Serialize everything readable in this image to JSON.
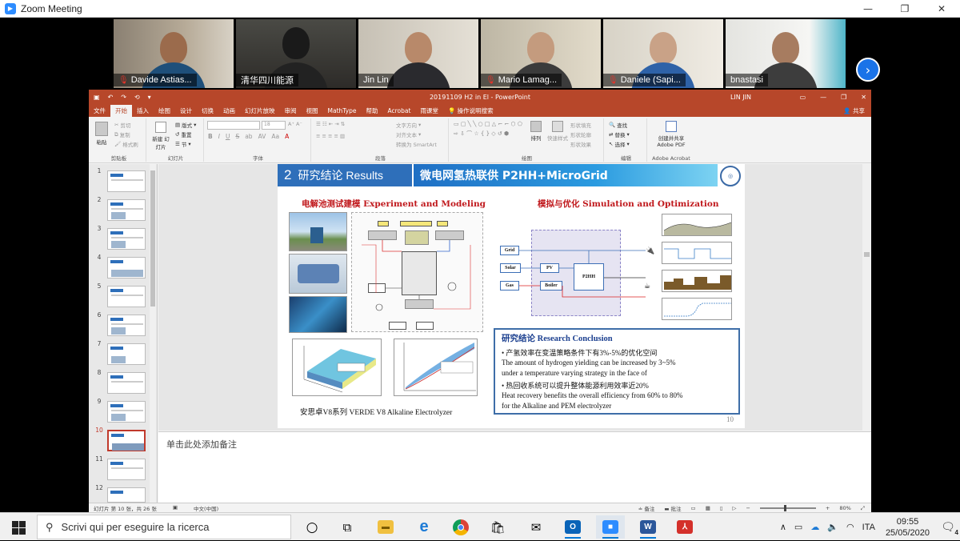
{
  "zoom": {
    "title": "Zoom Meeting",
    "window_controls": [
      "—",
      "❐",
      "✕"
    ],
    "participants": [
      {
        "name": "Davide Astias..."
      },
      {
        "name": "清华四川能源"
      },
      {
        "name": "Jin Lin"
      },
      {
        "name": "Mario Lamag..."
      },
      {
        "name": "Daniele (Sapi..."
      },
      {
        "name": "bnastasi"
      }
    ],
    "next_page_icon": "chevron-right-icon"
  },
  "ppt": {
    "doc_title": "20191109 H2 in El - PowerPoint",
    "user": "LIN JIN",
    "quick_access": [
      "▣",
      "↶",
      "↷",
      "⟲",
      "▾"
    ],
    "win_controls": [
      "▭",
      "—",
      "❐",
      "✕"
    ],
    "tabs": [
      "文件",
      "开始",
      "插入",
      "绘图",
      "设计",
      "切换",
      "动画",
      "幻灯片放映",
      "审阅",
      "视图",
      "MathType",
      "帮助",
      "Acrobat",
      "雨课堂",
      "操作说明搜索"
    ],
    "selected_tab": "开始",
    "share": "共享",
    "ribbon": {
      "clipboard": {
        "paste": "粘贴",
        "cut": "剪切",
        "copy": "复制",
        "format": "格式刷",
        "label": "剪贴板"
      },
      "slides": {
        "new": "新建 幻灯片",
        "layout": "版式",
        "reset": "重置",
        "section": "节",
        "label": "幻灯片"
      },
      "font": {
        "size": "18",
        "bold": "B",
        "italic": "I",
        "underline": "U",
        "strike": "S",
        "shadow": "ab",
        "label": "字体"
      },
      "paragraph": {
        "dir": "文字方向",
        "align": "对齐文本",
        "smartart": "转换为 SmartArt",
        "label": "段落"
      },
      "drawing": {
        "arrange": "排列",
        "quick": "快速样式",
        "fill": "形状填充",
        "outline": "形状轮廓",
        "effect": "形状效果",
        "label": "绘图"
      },
      "editing": {
        "find": "查找",
        "replace": "替换",
        "select": "选择",
        "label": "编辑"
      },
      "acrobat": {
        "create": "创建并共享 Adobe PDF",
        "label": "Adobe Acrobat"
      }
    },
    "thumbs": [
      "1",
      "2",
      "3",
      "4",
      "5",
      "6",
      "7",
      "8",
      "9",
      "10",
      "11",
      "12"
    ],
    "selected_slide": "10",
    "slide": {
      "section_num": "2",
      "section_title": "研究结论 Results",
      "banner": "微电网氢热联供 P2HH+MicroGrid",
      "left_heading": "电解池测试建模 Experiment and Modeling",
      "right_heading": "模拟与优化 Simulation and Optimization",
      "caption": "安思卓V8系列   VERDE V8 Alkaline Electrolyzer",
      "flow_boxes": {
        "grid": "Grid",
        "solar": "Solar",
        "gas": "Gas",
        "pv": "PV",
        "boiler": "Boiler",
        "p2hh": "P2HH"
      },
      "conclusion": {
        "title": "研究结论 Research Conclusion",
        "lines": [
          "•   产氢效率在变温策略条件下有3%-5%的优化空间",
          "      The amount of hydrogen yielding can be increased by 3~5%",
          "  under a temperature varying strategy in the face of",
          "•   热回收系统可以提升整体能源利用效率近20%",
          "      Heat recovery benefits the overall efficiency from 60% to 80%",
          "  for the Alkaline and PEM electrolyzer"
        ]
      },
      "page_num": "10"
    },
    "notes_placeholder": "单击此处添加备注",
    "status": {
      "slide_info": "幻灯片 第 10 张，共 26 张",
      "lang": "中文(中国)",
      "notes": "备注",
      "comments": "批注",
      "zoom": "80%"
    }
  },
  "taskbar": {
    "search_placeholder": "Scrivi qui per eseguire la ricerca",
    "tray": {
      "lang": "ITA",
      "time": "09:55",
      "date": "25/05/2020",
      "notifications": "4"
    }
  }
}
